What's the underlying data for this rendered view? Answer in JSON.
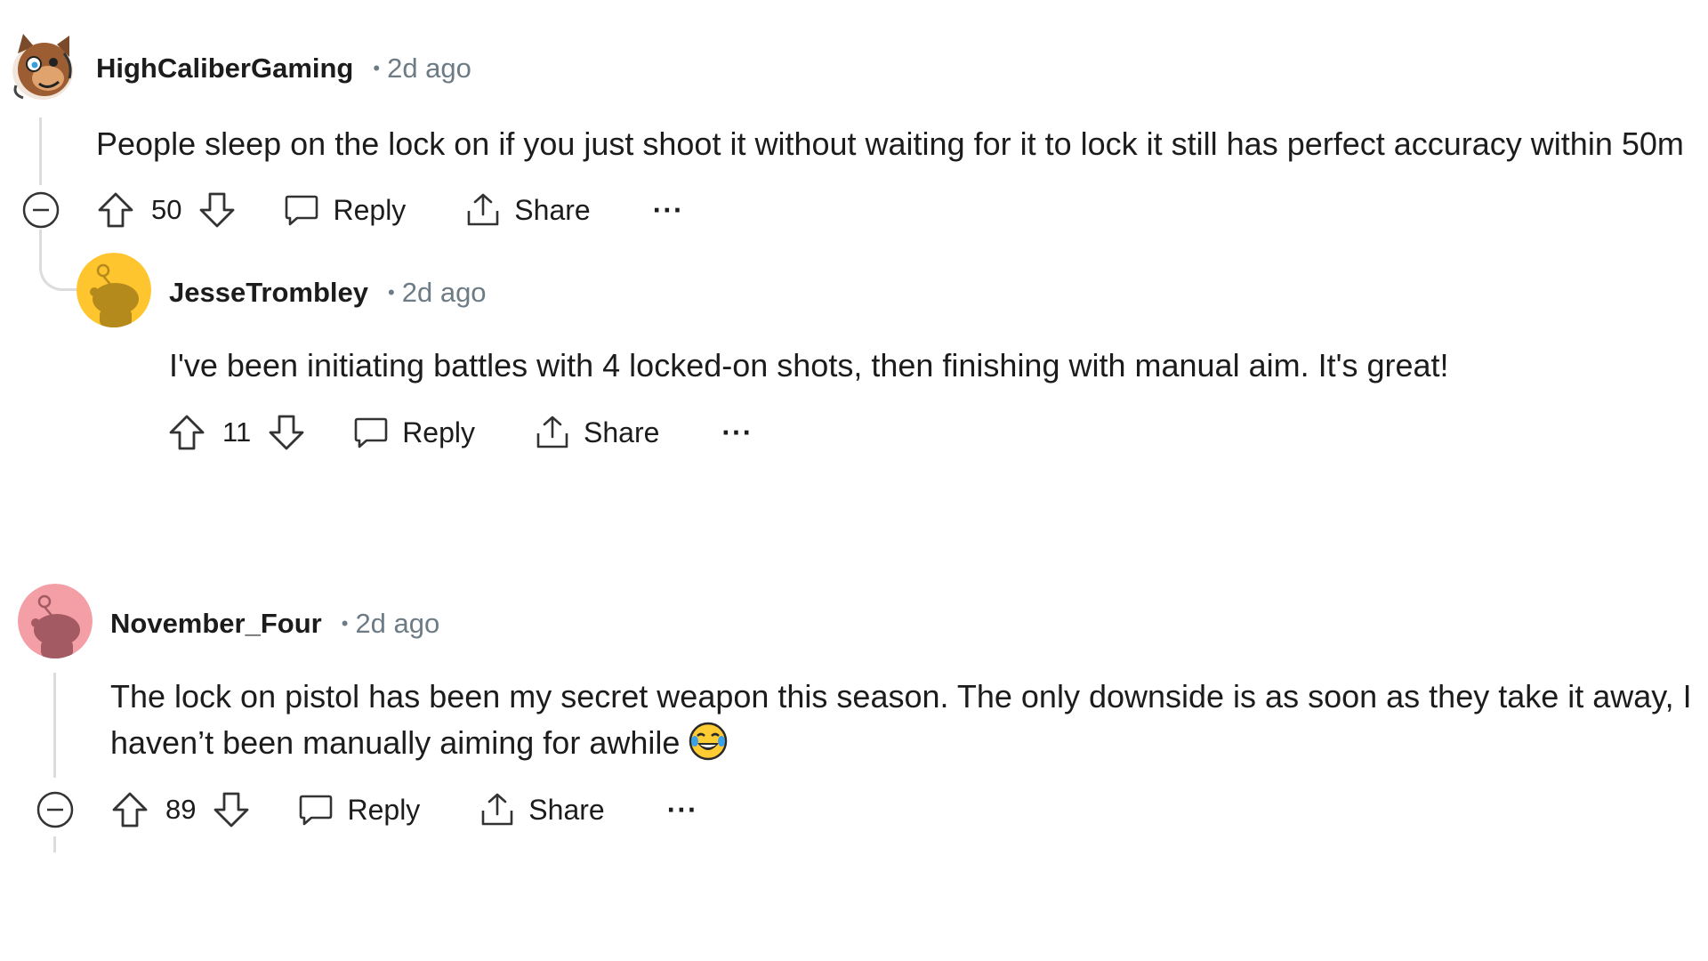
{
  "comments": [
    {
      "username": "HighCaliberGaming",
      "separator": "•",
      "time": "2d ago",
      "body": "People sleep on the lock on if you just shoot it without waiting for it to lock it still has perfect accuracy within 50m",
      "score": "50",
      "reply_label": "Reply",
      "share_label": "Share",
      "more_label": "···",
      "avatar_icon": "brown-bear-character-avatar",
      "replies": [
        {
          "username": "JesseTrombley",
          "separator": "•",
          "time": "2d ago",
          "body": "I've been initiating battles with 4 locked-on shots, then finishing with manual aim. It's great!",
          "score": "11",
          "reply_label": "Reply",
          "share_label": "Share",
          "more_label": "···",
          "avatar_color": "#FFC52E",
          "avatar_icon": "snoo-default-avatar"
        }
      ]
    },
    {
      "username": "November_Four",
      "separator": "•",
      "time": "2d ago",
      "body_line1": "The lock on pistol has been my secret weapon this season. The only downside is as soon as they take it away, I",
      "body_line2": "haven’t been manually aiming for awhile",
      "emoji": "face-with-tears-of-joy-emoji",
      "score": "89",
      "reply_label": "Reply",
      "share_label": "Share",
      "more_label": "···",
      "avatar_color": "#F49EA6",
      "avatar_icon": "snoo-default-avatar"
    }
  ],
  "colors": {
    "text": "#1c1c1c",
    "meta": "#6d7b85",
    "thread_line": "#dcdcdc"
  }
}
